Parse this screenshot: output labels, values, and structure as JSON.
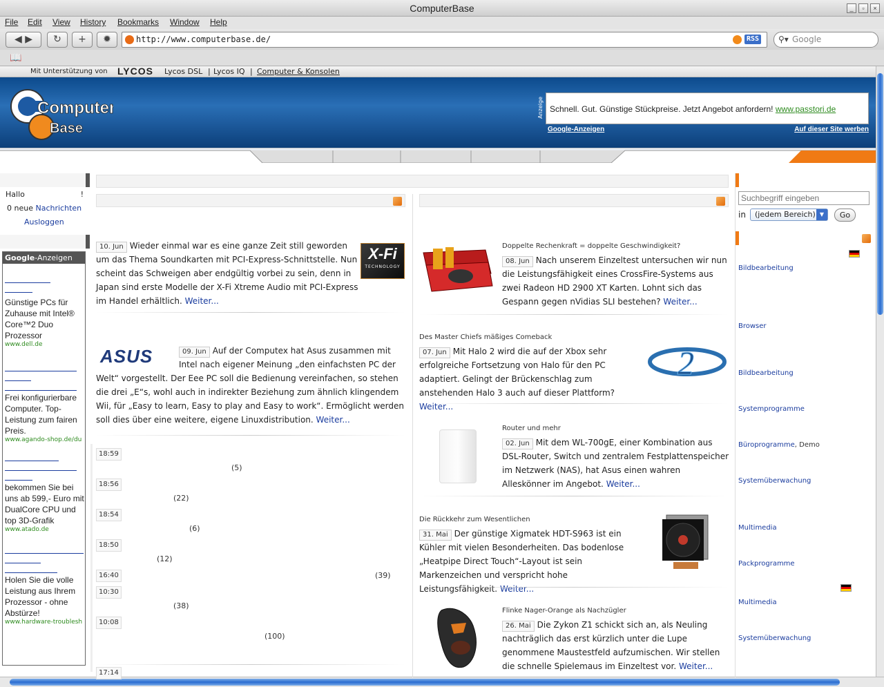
{
  "window": {
    "title": "ComputerBase"
  },
  "menu": [
    "File",
    "Edit",
    "View",
    "History",
    "Bookmarks",
    "Window",
    "Help"
  ],
  "toolbar": {
    "url": "http://www.computerbase.de/",
    "rss_label": "RSS",
    "search_placeholder": "Google"
  },
  "site": {
    "support_text": "Mit Unterstützung von",
    "support_brand": "LYCOS",
    "support_links": [
      "Lycos DSL",
      "Lycos IQ",
      "Computer & Konsolen"
    ],
    "logo_top": "Computer",
    "logo_bottom": "Base",
    "ad": {
      "vertical_label": "Anzeige",
      "text": "Schnell. Gut. Günstige Stückpreise. Jetzt Angebot anfordern!",
      "link": "www.passtori.de",
      "footer_left": "Google-Anzeigen",
      "footer_right": "Auf dieser Site werben"
    }
  },
  "user": {
    "hello": "Hallo",
    "excl": "!",
    "messages_count": "0 neue",
    "messages_link": "Nachrichten",
    "logout": "Ausloggen"
  },
  "google_ads": {
    "header_brand": "Google",
    "header_suffix": "-Anzeigen",
    "ads": [
      {
        "text": "Günstige PCs für Zuhause mit Intel® Core™2 Duo Prozessor",
        "url": "www.dell.de"
      },
      {
        "text": "Frei konfigurierbare Computer. Top-Leistung zum fairen Preis.",
        "url": "www.agando-shop.de/du"
      },
      {
        "text": "bekommen Sie bei uns ab 599,- Euro mit DualCore CPU und top 3D-Grafik",
        "url": "www.atado.de"
      },
      {
        "text": "Holen Sie die volle Leistung aus Ihrem Prozessor - ohne Abstürze!",
        "url": "www.hardware-troublesh"
      }
    ]
  },
  "left_news": [
    {
      "date": "10. Jun",
      "text": "Wieder einmal war es eine ganze Zeit still geworden um das Thema Soundkarten mit PCI-Express-Schnittstelle. Nun scheint das Schweigen aber endgültig vorbei zu sein, denn in Japan sind erste Modelle der X-Fi Xtreme Audio mit PCI-Express im Handel erhältlich.",
      "more": "Weiter...",
      "img": "X-Fi",
      "img_sub": "TECHNOLOGY"
    },
    {
      "date": "09. Jun",
      "text": "Auf der Computex hat Asus zusammen mit Intel nach eigener Meinung „den einfachsten PC der Welt“ vorgestellt. Der Eee PC soll die Bedienung vereinfachen, so stehen die drei „E“s, wohl auch in indirekter Beziehung zum ähnlich klingendem Wii, für „Easy to learn, Easy to play and Easy to work“. Ermöglicht werden soll dies über eine weitere, eigene Linuxdistribution.",
      "more": "Weiter...",
      "img": "ASUS"
    }
  ],
  "ticker": [
    {
      "time": "18:59",
      "count": "(5)"
    },
    {
      "time": "18:56",
      "count": "(22)"
    },
    {
      "time": "18:54",
      "count": "(6)"
    },
    {
      "time": "18:50",
      "count": "(12)"
    },
    {
      "time": "16:40",
      "count": "(39)"
    },
    {
      "time": "10:30",
      "count": "(38)"
    },
    {
      "time": "10:08",
      "count": "(100)"
    },
    {
      "time": "17:14",
      "count": ""
    }
  ],
  "right_news": [
    {
      "kicker": "Doppelte Rechenkraft = doppelte Geschwindigkeit?",
      "date": "08. Jun",
      "text": "Nach unserem Einzeltest untersuchen wir nun die Leistungsfähigkeit eines CrossFire-Systems aus zwei Radeon HD 2900 XT Karten. Lohnt sich das Gespann gegen nVidias SLI bestehen?",
      "more": "Weiter..."
    },
    {
      "kicker": "Des Master Chiefs mäßiges Comeback",
      "date": "07. Jun",
      "text": "Mit Halo 2 wird die auf der Xbox sehr erfolgreiche Fortsetzung von Halo für den PC adaptiert. Gelingt der Brückenschlag zum anstehenden Halo 3 auch auf dieser Plattform?",
      "more": "Weiter..."
    },
    {
      "kicker": "Router und mehr",
      "date": "02. Jun",
      "text": "Mit dem WL-700gE, einer Kombination aus DSL-Router, Switch und zentralem Festplattenspeicher im Netzwerk (NAS), hat Asus einen wahren Alleskönner im Angebot.",
      "more": "Weiter..."
    },
    {
      "kicker": "Die Rückkehr zum Wesentlichen",
      "date": "31. Mai",
      "text": "Der günstige Xigmatek HDT-S963 ist ein Kühler mit vielen Besonderheiten. Das bodenlose „Heatpipe Direct Touch“-Layout ist sein Markenzeichen und verspricht hohe Leistungsfähigkeit.",
      "more": "Weiter..."
    },
    {
      "kicker": "Flinke Nager-Orange als Nachzügler",
      "date": "26. Mai",
      "text": "Die Zykon Z1 schickt sich an, als Neuling nachträglich das erst kürzlich unter die Lupe genommene Maustestfeld aufzumischen. Wir stellen die schnelle Spielemaus im Einzeltest vor.",
      "more": "Weiter..."
    }
  ],
  "sidebar_search": {
    "placeholder": "Suchbegriff eingeben",
    "in_label": "in",
    "scope": "(jedem Bereich)",
    "go": "Go"
  },
  "downloads": [
    "Bildbearbeitung",
    "Browser",
    "Bildbearbeitung",
    "Systemprogramme",
    "Büroprogramme",
    "Systemüberwachung",
    "Multimedia",
    "Packprogramme",
    "Multimedia",
    "Systemüberwachung"
  ],
  "downloads_extra": ", Demo"
}
